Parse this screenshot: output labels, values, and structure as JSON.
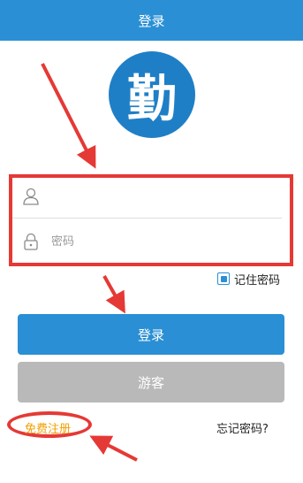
{
  "header": {
    "title": "登录"
  },
  "logo": {
    "glyph": "勤"
  },
  "login_form": {
    "username": {
      "value": "",
      "placeholder": ""
    },
    "password": {
      "value": "",
      "placeholder": "密码"
    }
  },
  "remember_password": {
    "label": "记住密码",
    "checked": true
  },
  "buttons": {
    "login_label": "登录",
    "guest_label": "游客"
  },
  "links": {
    "register_label": "免费注册",
    "forgot_label": "忘记密码?"
  },
  "colors": {
    "primary": "#2a8fd4",
    "guest_button": "#b9b9b9",
    "annotation": "#e53935",
    "register_link": "#f0a000"
  },
  "icons": [
    "user-icon",
    "lock-icon",
    "checkbox-icon",
    "annotation-arrow"
  ]
}
